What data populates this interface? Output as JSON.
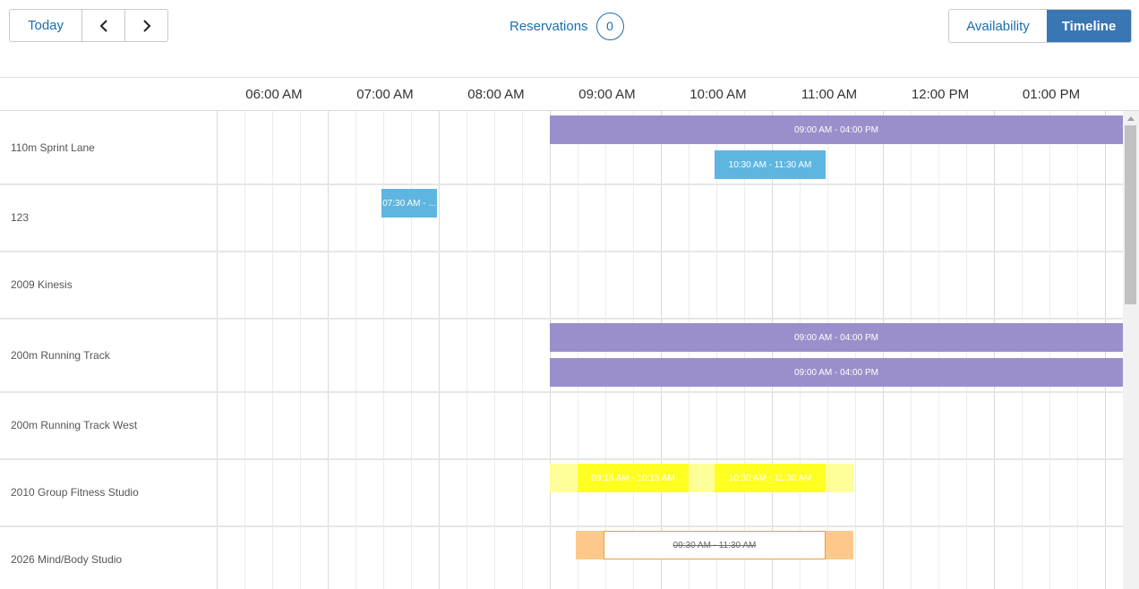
{
  "toolbar": {
    "today_label": "Today",
    "prev_icon": "chevron-left-icon",
    "next_icon": "chevron-right-icon",
    "reservations_label": "Reservations",
    "reservations_count": "0",
    "view_availability_label": "Availability",
    "view_timeline_label": "Timeline",
    "active_view": "Timeline"
  },
  "timeline": {
    "hours": [
      "06:00 AM",
      "07:00 AM",
      "08:00 AM",
      "09:00 AM",
      "10:00 AM",
      "11:00 AM",
      "12:00 PM",
      "01:00 PM"
    ],
    "resources": [
      {
        "name": "110m Sprint Lane",
        "events": [
          {
            "label": "09:00 AM - 04:00 PM",
            "color": "#9b8fcb"
          },
          {
            "label": "10:30 AM - 11:30 AM",
            "color": "#5eb5e0"
          }
        ]
      },
      {
        "name": "123",
        "events": [
          {
            "label": "07:30 AM - ...",
            "color": "#5eb5e0"
          }
        ]
      },
      {
        "name": "2009 Kinesis",
        "events": []
      },
      {
        "name": "200m Running Track",
        "events": [
          {
            "label": "09:00 AM - 04:00 PM",
            "color": "#9b8fcb"
          },
          {
            "label": "09:00 AM - 04:00 PM",
            "color": "#9b8fcb"
          }
        ]
      },
      {
        "name": "200m Running Track West",
        "events": []
      },
      {
        "name": "2010 Group Fitness Studio",
        "events": [
          {
            "label": "09:15 AM - 10:15 AM",
            "color": "#ffff22"
          },
          {
            "label": "10:30 AM - 11:30 AM",
            "color": "#ffff22"
          }
        ]
      },
      {
        "name": "2026 Mind/Body Studio",
        "events": [
          {
            "label": "09:30 AM - 11:30 AM",
            "color": "#e8a030",
            "status": "cancelled"
          }
        ]
      }
    ]
  }
}
